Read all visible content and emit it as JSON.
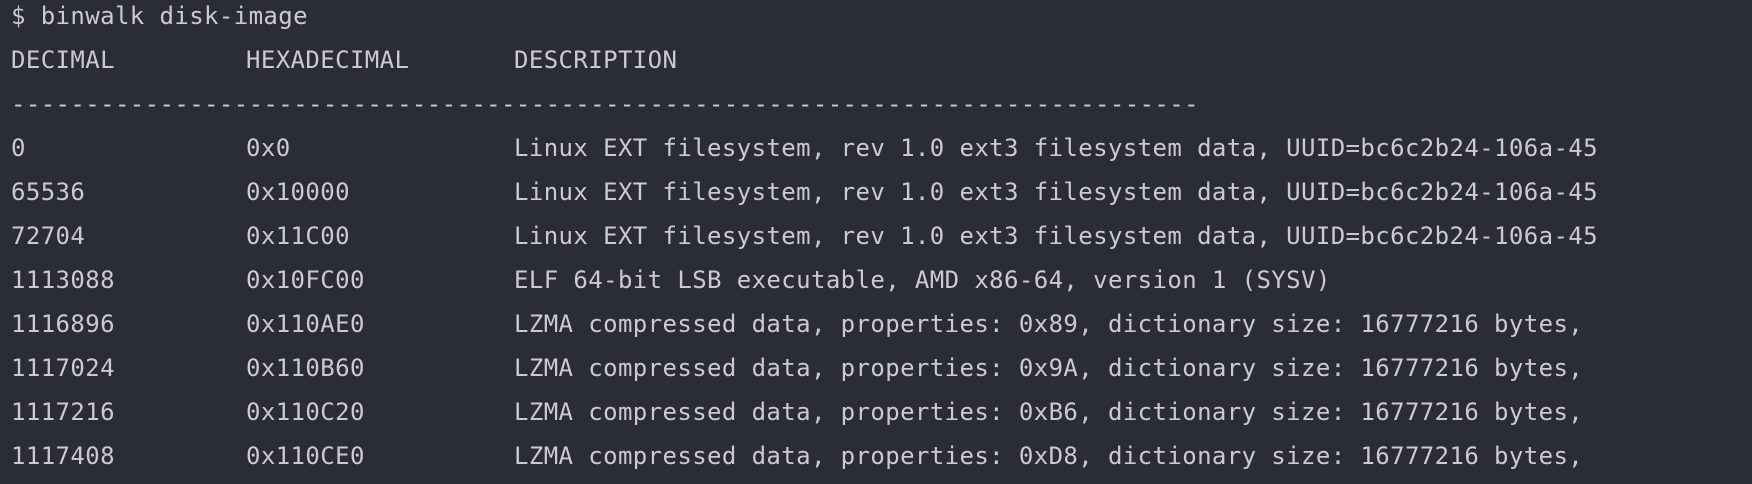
{
  "command": "$ binwalk disk-image",
  "headers": {
    "decimal": "DECIMAL",
    "hexadecimal": "HEXADECIMAL",
    "description": "DESCRIPTION"
  },
  "separator": "--------------------------------------------------------------------------------",
  "rows": [
    {
      "decimal": "0",
      "hex": "0x0",
      "description": "Linux EXT filesystem, rev 1.0 ext3 filesystem data, UUID=bc6c2b24-106a-45"
    },
    {
      "decimal": "65536",
      "hex": "0x10000",
      "description": "Linux EXT filesystem, rev 1.0 ext3 filesystem data, UUID=bc6c2b24-106a-45"
    },
    {
      "decimal": "72704",
      "hex": "0x11C00",
      "description": "Linux EXT filesystem, rev 1.0 ext3 filesystem data, UUID=bc6c2b24-106a-45"
    },
    {
      "decimal": "1113088",
      "hex": "0x10FC00",
      "description": "ELF 64-bit LSB executable, AMD x86-64, version 1 (SYSV)"
    },
    {
      "decimal": "1116896",
      "hex": "0x110AE0",
      "description": "LZMA compressed data, properties: 0x89, dictionary size: 16777216 bytes, "
    },
    {
      "decimal": "1117024",
      "hex": "0x110B60",
      "description": "LZMA compressed data, properties: 0x9A, dictionary size: 16777216 bytes, "
    },
    {
      "decimal": "1117216",
      "hex": "0x110C20",
      "description": "LZMA compressed data, properties: 0xB6, dictionary size: 16777216 bytes, "
    },
    {
      "decimal": "1117408",
      "hex": "0x110CE0",
      "description": "LZMA compressed data, properties: 0xD8, dictionary size: 16777216 bytes, "
    }
  ],
  "colors": {
    "background": "#2b2d35",
    "text": "#c9cbd0"
  }
}
